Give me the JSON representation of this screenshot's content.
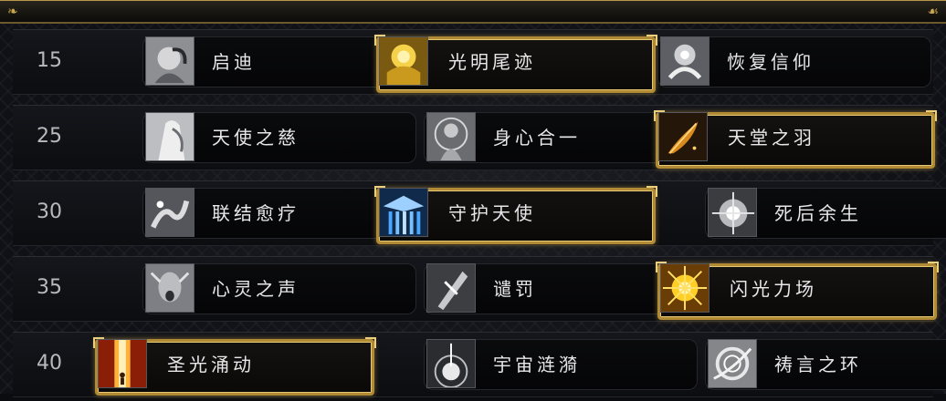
{
  "rows": [
    {
      "level": "15",
      "talents": [
        {
          "name": "启迪",
          "icon": "enlightenment-icon",
          "selected": false
        },
        {
          "name": "光明尾迹",
          "icon": "trail-of-light-icon",
          "selected": true
        },
        {
          "name": "恢复信仰",
          "icon": "renewed-faith-icon",
          "selected": false
        }
      ]
    },
    {
      "level": "25",
      "talents": [
        {
          "name": "天使之慈",
          "icon": "angels-mercy-icon",
          "selected": false
        },
        {
          "name": "身心合一",
          "icon": "body-and-mind-icon",
          "selected": false
        },
        {
          "name": "天堂之羽",
          "icon": "angelic-feather-icon",
          "selected": true
        }
      ]
    },
    {
      "level": "30",
      "talents": [
        {
          "name": "联结愈疗",
          "icon": "binding-heal-icon",
          "selected": false
        },
        {
          "name": "守护天使",
          "icon": "guardian-angel-icon",
          "selected": true
        },
        {
          "name": "死后余生",
          "icon": "afterlife-icon",
          "selected": false
        }
      ]
    },
    {
      "level": "35",
      "talents": [
        {
          "name": "心灵之声",
          "icon": "psychic-voice-icon",
          "selected": false
        },
        {
          "name": "谴罚",
          "icon": "censure-icon",
          "selected": false
        },
        {
          "name": "闪光力场",
          "icon": "shining-force-icon",
          "selected": true
        }
      ]
    },
    {
      "level": "40",
      "talents": [
        {
          "name": "圣光涌动",
          "icon": "surge-of-light-icon",
          "selected": true
        },
        {
          "name": "宇宙涟漪",
          "icon": "cosmic-ripple-icon",
          "selected": false
        },
        {
          "name": "祷言之环",
          "icon": "circle-of-healing-icon",
          "selected": false
        }
      ]
    }
  ],
  "colors": {
    "selected_border": "#b08a35",
    "level_text": "#b8b9bd",
    "talent_text": "#e8e8ea"
  }
}
